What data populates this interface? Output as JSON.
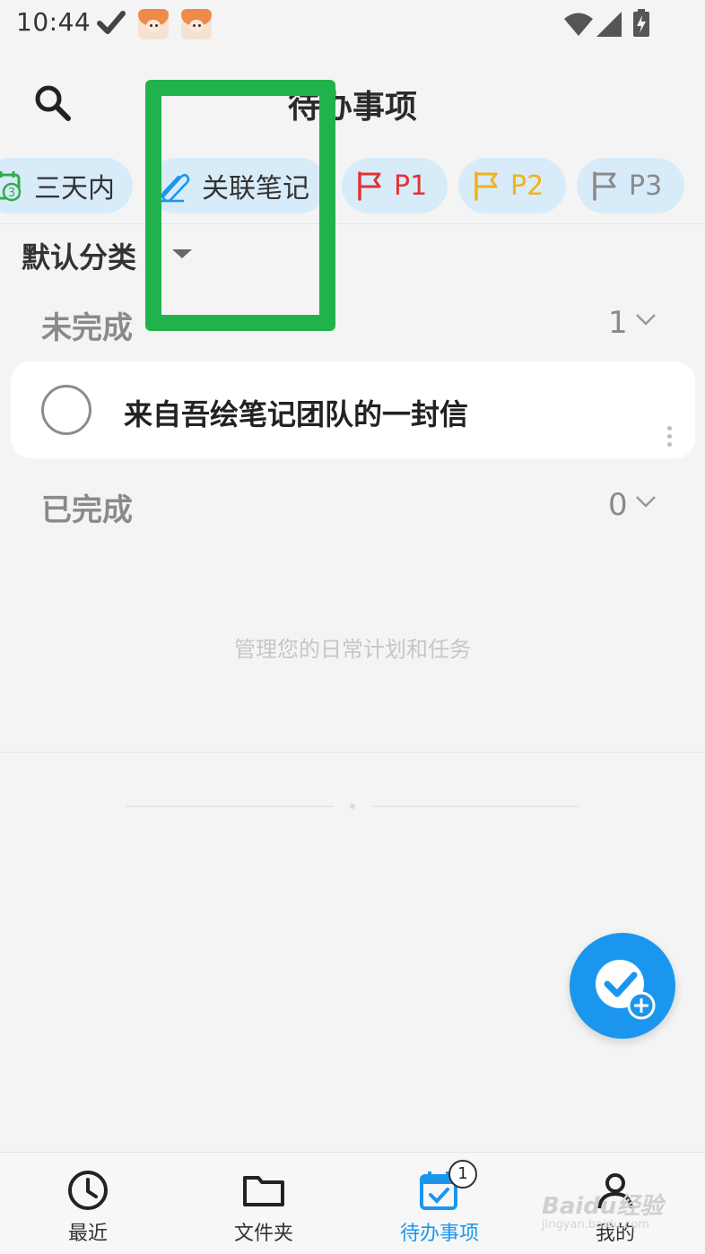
{
  "status_bar": {
    "time": "10:44"
  },
  "header": {
    "title": "待办事项"
  },
  "filter_chips": [
    {
      "label": "三天内",
      "icon": "calendar-3-icon",
      "color": "#333333"
    },
    {
      "label": "关联笔记",
      "icon": "paperclip-icon",
      "color": "#333333"
    },
    {
      "label": "P1",
      "icon": "flag-icon",
      "color": "#e03434"
    },
    {
      "label": "P2",
      "icon": "flag-icon",
      "color": "#f1b21c"
    },
    {
      "label": "P3",
      "icon": "flag-icon",
      "color": "#8a8a8a"
    }
  ],
  "category": {
    "label": "默认分类"
  },
  "sections": {
    "incomplete": {
      "label": "未完成",
      "count": "1"
    },
    "complete": {
      "label": "已完成",
      "count": "0"
    }
  },
  "todos": [
    {
      "text": "来自吾绘笔记团队的一封信",
      "done": false
    }
  ],
  "empty_hint": "管理您的日常计划和任务",
  "bottom_nav": [
    {
      "label": "最近",
      "icon": "clock-icon",
      "active": false
    },
    {
      "label": "文件夹",
      "icon": "folder-icon",
      "active": false
    },
    {
      "label": "待办事项",
      "icon": "calendar-check-icon",
      "active": true,
      "badge": "1"
    },
    {
      "label": "我的",
      "icon": "person-icon",
      "active": false
    }
  ],
  "watermark": {
    "text": "Baidu经验",
    "sub": "jingyan.baidu.com"
  },
  "colors": {
    "accent": "#1a96ef",
    "chip_bg": "#d8ebf9",
    "highlight": "#22b24c"
  }
}
